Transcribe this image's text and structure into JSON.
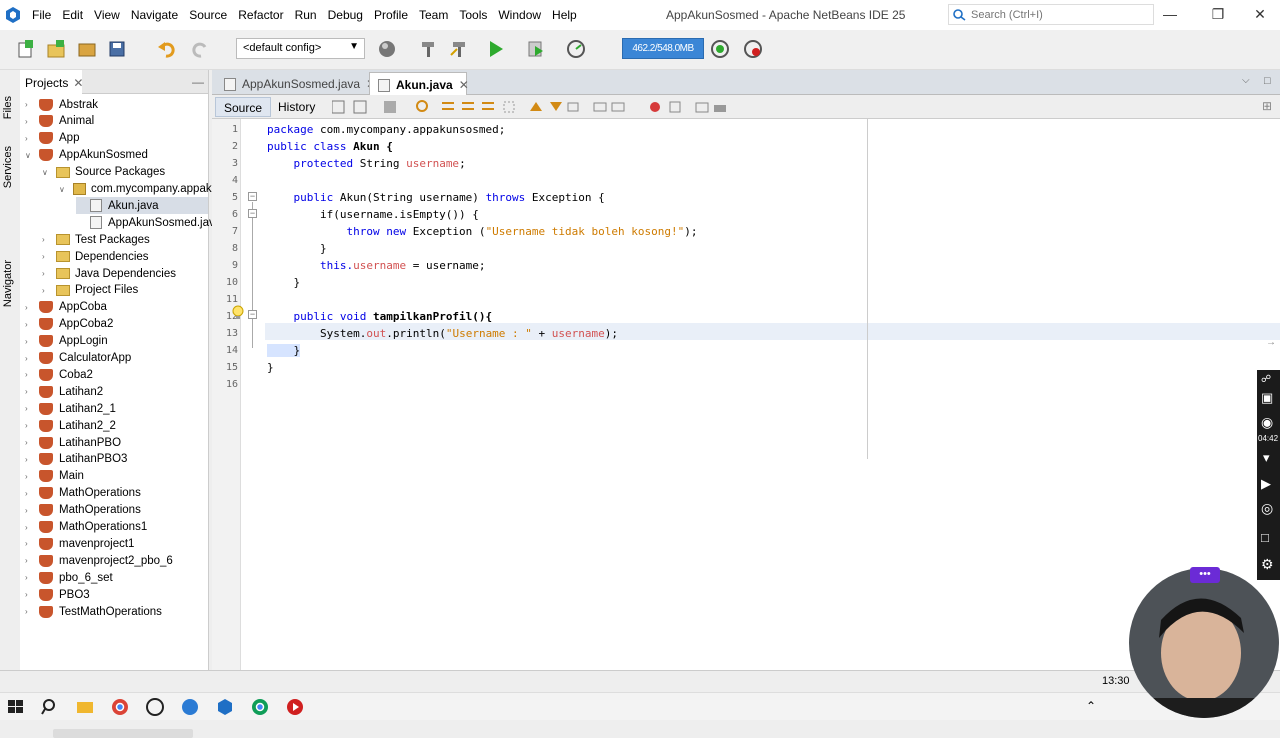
{
  "window": {
    "title": "AppAkunSosmed - Apache NetBeans IDE 25",
    "menu": [
      "File",
      "Edit",
      "View",
      "Navigate",
      "Source",
      "Refactor",
      "Run",
      "Debug",
      "Profile",
      "Team",
      "Tools",
      "Window",
      "Help"
    ],
    "search_placeholder": "Search (Ctrl+I)"
  },
  "toolbar": {
    "config": "<default config>",
    "memory": "462.2/548.0MB"
  },
  "sidebar": {
    "vertical_tabs": [
      "Files",
      "Services",
      "Navigator"
    ],
    "projects_tab": "Projects",
    "tree": [
      {
        "label": "Abstrak",
        "type": "project"
      },
      {
        "label": "Animal",
        "type": "project"
      },
      {
        "label": "App",
        "type": "project"
      },
      {
        "label": "AppAkunSosmed",
        "type": "project"
      },
      {
        "label": "Source Packages",
        "type": "folder"
      },
      {
        "label": "com.mycompany.appaku",
        "type": "package"
      },
      {
        "label": "Akun.java",
        "type": "file"
      },
      {
        "label": "AppAkunSosmed.java",
        "type": "file"
      },
      {
        "label": "Test Packages",
        "type": "folder"
      },
      {
        "label": "Dependencies",
        "type": "folder"
      },
      {
        "label": "Java Dependencies",
        "type": "folder"
      },
      {
        "label": "Project Files",
        "type": "folder"
      },
      {
        "label": "AppCoba",
        "type": "project"
      },
      {
        "label": "AppCoba2",
        "type": "project"
      },
      {
        "label": "AppLogin",
        "type": "project"
      },
      {
        "label": "CalculatorApp",
        "type": "project"
      },
      {
        "label": "Coba2",
        "type": "project"
      },
      {
        "label": "Latihan2",
        "type": "project"
      },
      {
        "label": "Latihan2_1",
        "type": "project"
      },
      {
        "label": "Latihan2_2",
        "type": "project"
      },
      {
        "label": "LatihanPBO",
        "type": "project"
      },
      {
        "label": "LatihanPBO3",
        "type": "project"
      },
      {
        "label": "Main",
        "type": "project"
      },
      {
        "label": "MathOperations",
        "type": "project"
      },
      {
        "label": "MathOperations",
        "type": "project"
      },
      {
        "label": "MathOperations1",
        "type": "project"
      },
      {
        "label": "mavenproject1",
        "type": "project"
      },
      {
        "label": "mavenproject2_pbo_6",
        "type": "project"
      },
      {
        "label": "pbo_6_set",
        "type": "project"
      },
      {
        "label": "PBO3",
        "type": "project"
      },
      {
        "label": "TestMathOperations",
        "type": "project"
      }
    ]
  },
  "editor": {
    "tabs": [
      "AppAkunSosmed.java",
      "Akun.java"
    ],
    "active_tab": "Akun.java",
    "source_label": "Source",
    "history_label": "History",
    "lines": [
      "1",
      "2",
      "3",
      "4",
      "5",
      "6",
      "7",
      "8",
      "9",
      "10",
      "11",
      "12",
      "13",
      "14",
      "15",
      "16"
    ],
    "code": {
      "l1_a": "package",
      "l1_b": " com.mycompany.appakunsosmed;",
      "l2_a": "public class",
      "l2_b": " Akun {",
      "l3_a": "    protected",
      "l3_b": " String ",
      "l3_c": "username",
      "l3_d": ";",
      "l5_a": "    public",
      "l5_b": " Akun(String username) ",
      "l5_c": "throws",
      "l5_d": " Exception {",
      "l6_a": "        if(username.isEmpty()) {",
      "l7_a": "            throw new",
      "l7_b": " Exception (",
      "l7_c": "\"Username tidak boleh kosong!\"",
      "l7_d": ");",
      "l8_a": "        }",
      "l9_a": "        this.",
      "l9_b": "username",
      "l9_c": " = username;",
      "l10_a": "    }",
      "l12_a": "    public void",
      "l12_b": " tampilkanProfil(){",
      "l13_a": "        System.",
      "l13_b": "out",
      "l13_c": ".println(",
      "l13_d": "\"Username : \"",
      "l13_e": " + ",
      "l13_f": "username",
      "l13_g": ");",
      "l14_a": "    }",
      "l15_a": "}"
    }
  },
  "status": {
    "position": "13:30"
  },
  "rec_time": "04:42"
}
